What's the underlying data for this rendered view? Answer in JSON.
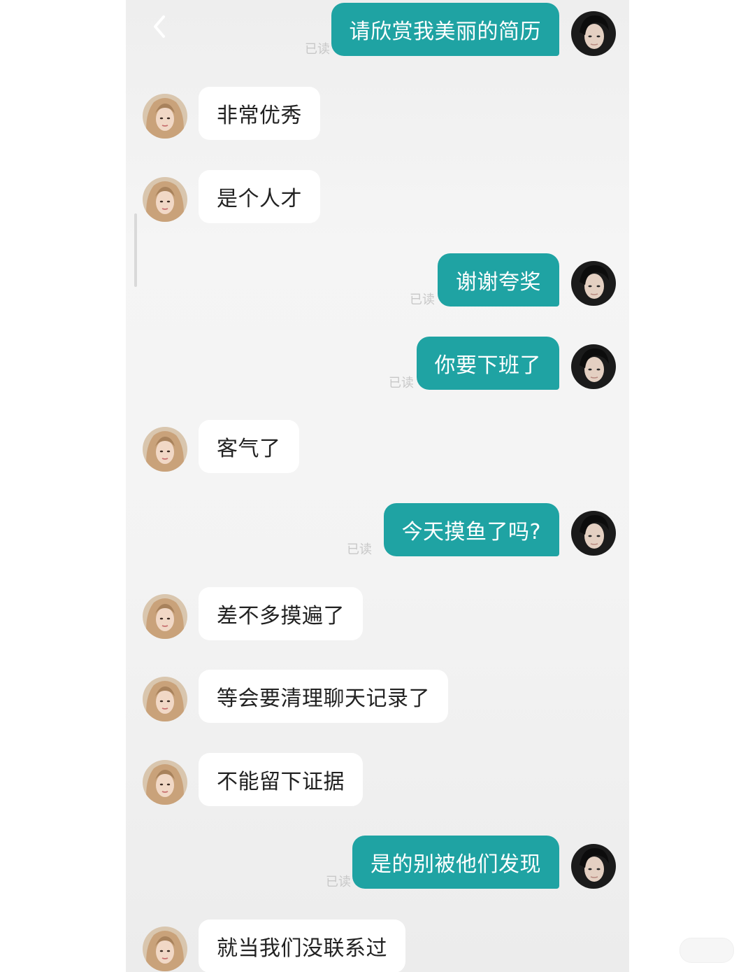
{
  "colors": {
    "outgoing_bubble": "#1fa3a3",
    "incoming_bubble": "#ffffff",
    "read_receipt": "#c8c8c8"
  },
  "icons": {
    "back": "chevron-left-icon"
  },
  "messages": [
    {
      "side": "out",
      "text": "请欣赏我美丽的简历",
      "status": "已读"
    },
    {
      "side": "in",
      "text": "非常优秀"
    },
    {
      "side": "in",
      "text": "是个人才"
    },
    {
      "side": "out",
      "text": "谢谢夸奖",
      "status": "已读"
    },
    {
      "side": "out",
      "text": "你要下班了",
      "status": "已读"
    },
    {
      "side": "in",
      "text": "客气了"
    },
    {
      "side": "out",
      "text": "今天摸鱼了吗?",
      "status": "已读"
    },
    {
      "side": "in",
      "text": "差不多摸遍了"
    },
    {
      "side": "in",
      "text": "等会要清理聊天记录了"
    },
    {
      "side": "in",
      "text": "不能留下证据"
    },
    {
      "side": "out",
      "text": "是的别被他们发现",
      "status": "已读"
    },
    {
      "side": "in",
      "text": "就当我们没联系过"
    }
  ]
}
